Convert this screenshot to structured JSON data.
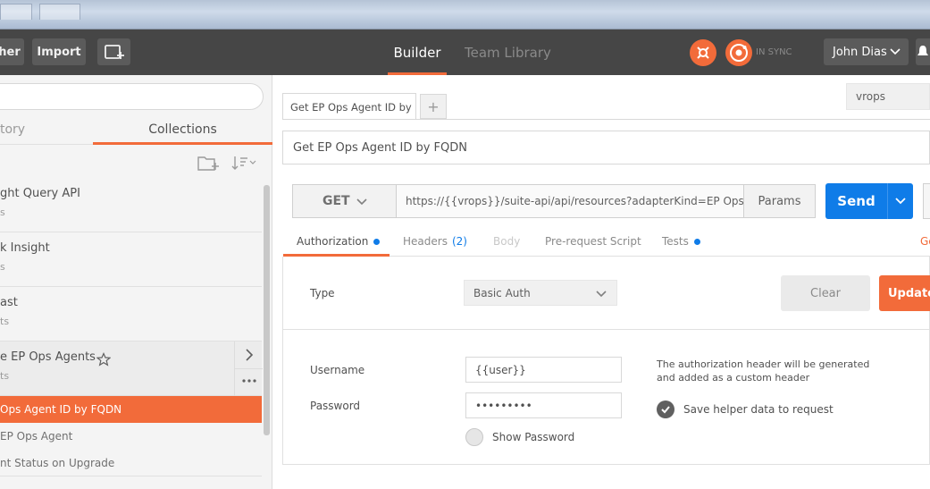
{
  "header": {
    "partial_button_label": "her",
    "import_label": "Import",
    "builder_label": "Builder",
    "team_library_label": "Team Library",
    "sync_label": "IN SYNC",
    "user_name": "John Dias"
  },
  "sidebar": {
    "tabs": {
      "history": "tory",
      "collections": "Collections"
    },
    "collections": [
      {
        "name": "ght Query API",
        "sub": "s"
      },
      {
        "name": "k Insight",
        "sub": "s"
      },
      {
        "name": "ast",
        "sub": "ts"
      },
      {
        "name": "e EP Ops Agents",
        "sub": "ts"
      }
    ],
    "requests": [
      {
        "label": "Ops Agent ID by FQDN"
      },
      {
        "label": "EP Ops Agent"
      },
      {
        "label": "nt Status on Upgrade"
      }
    ]
  },
  "main": {
    "tab_title": "Get EP Ops Agent ID by FQDN",
    "environment": "vrops",
    "request_name": "Get EP Ops Agent ID by FQDN",
    "method": "GET",
    "url": "https://{{vrops}}/suite-api/api/resources?adapterKind=EP Ops Adapter",
    "params_label": "Params",
    "send_label": "Send",
    "request_tabs": {
      "authorization": "Authorization",
      "headers": "Headers",
      "headers_count": "(2)",
      "body": "Body",
      "prerequest": "Pre-request Script",
      "tests": "Tests",
      "generate_partial": "Ge"
    },
    "auth": {
      "type_label": "Type",
      "type_value": "Basic Auth",
      "clear_label": "Clear",
      "update_label": "Update Request",
      "username_label": "Username",
      "username_value": "{{user}}",
      "password_label": "Password",
      "password_value": "•••••••••",
      "note": "The authorization header will be generated and added as a custom header",
      "save_helper_label": "Save helper data to request",
      "show_password_label": "Show Password"
    }
  },
  "colors": {
    "accent": "#f26b3a",
    "send_blue": "#0f7ce8",
    "header_bg": "#464646"
  }
}
